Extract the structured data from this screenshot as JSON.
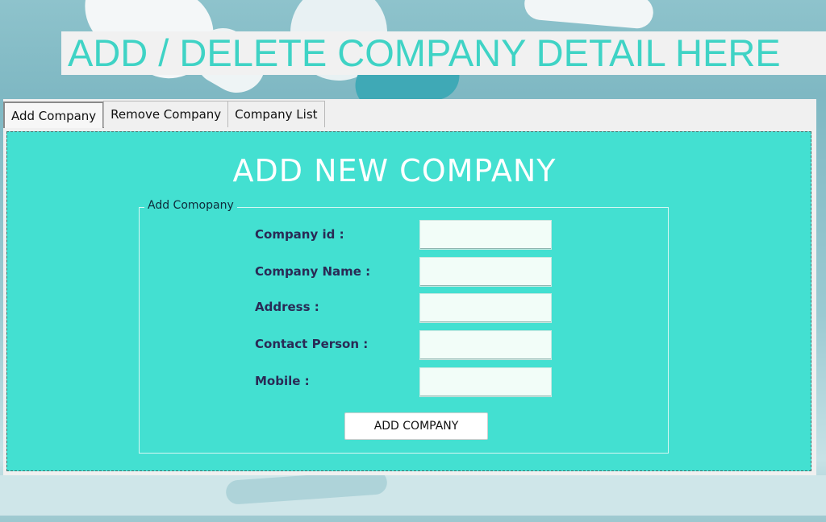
{
  "banner": {
    "title": "ADD / DELETE COMPANY DETAIL HERE"
  },
  "tabs": [
    {
      "label": "Add Company",
      "active": true
    },
    {
      "label": "Remove Company",
      "active": false
    },
    {
      "label": "Company List",
      "active": false
    }
  ],
  "panel": {
    "title": "ADD NEW COMPANY",
    "group_label": "Add Comopany",
    "fields": [
      {
        "label": "Company id :",
        "value": ""
      },
      {
        "label": "Company Name :",
        "value": ""
      },
      {
        "label": "Address  :",
        "value": ""
      },
      {
        "label": "Contact Person :",
        "value": ""
      },
      {
        "label": "Mobile :",
        "value": ""
      }
    ],
    "submit_label": "ADD COMPANY"
  },
  "colors": {
    "accent": "#43e0d1",
    "banner_text": "#3fd3c5",
    "label_text": "#2a2a55",
    "input_bg": "#f2fdf8"
  },
  "icons": []
}
